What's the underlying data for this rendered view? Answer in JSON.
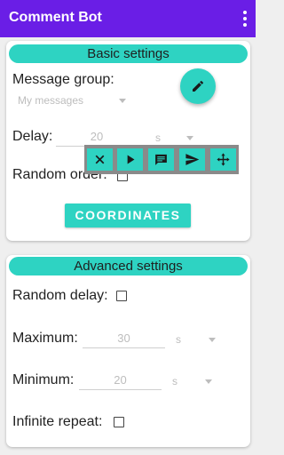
{
  "app": {
    "title": "Comment Bot"
  },
  "icons": {
    "overflow_menu": "more-vertical-icon",
    "edit": "pencil-icon",
    "close": "close-icon",
    "play": "play-icon",
    "comment": "comment-icon",
    "send": "send-icon",
    "move": "move-icon"
  },
  "colors": {
    "appbar": "#6a1ee6",
    "accent": "#2ed3c2",
    "toolbar": "#8a8a8a"
  },
  "basic": {
    "header": "Basic settings",
    "message_group_label": "Message group:",
    "message_group_value": "My messages",
    "delay_label": "Delay:",
    "delay_value": "20",
    "delay_unit": "s",
    "random_order_label": "Random order:",
    "coordinates_button": "COORDINATES"
  },
  "advanced": {
    "header": "Advanced settings",
    "random_delay_label": "Random delay:",
    "maximum_label": "Maximum:",
    "maximum_value": "30",
    "maximum_unit": "s",
    "minimum_label": "Minimum:",
    "minimum_value": "20",
    "minimum_unit": "s",
    "infinite_repeat_label": "Infinite repeat:"
  }
}
